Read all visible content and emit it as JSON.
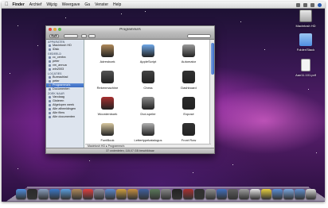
{
  "menubar": {
    "items": [
      "Finder",
      "Archief",
      "Wijzig",
      "Weergave",
      "Ga",
      "Venster",
      "Help"
    ]
  },
  "desktop": {
    "icons": [
      {
        "label": "Macintosh HD",
        "icon": "hard-drive-icon",
        "color": "#c8c8c8"
      },
      {
        "label": "Folder/Stack",
        "icon": "folder-icon",
        "color": "#6fa8e8"
      },
      {
        "label": "Aan11.101.pdf",
        "icon": "pdf-document-icon",
        "color": "#f2f2f2"
      }
    ]
  },
  "window": {
    "title": "Programma's",
    "search_placeholder": "",
    "sidebar": {
      "sections": [
        {
          "header": "APPARATEN",
          "items": [
            "Macintosh HD",
            "iDisk"
          ]
        },
        {
          "header": "GEDEELD",
          "items": [
            "cc_centra",
            "peter",
            "vm_annua",
            "win2003"
          ]
        },
        {
          "header": "LOCATIES",
          "items": [
            "Bureaublad",
            "peter",
            "Programma's",
            "Documenten"
          ]
        },
        {
          "header": "ZOEK NAAR",
          "items": [
            "Vandaag",
            "Gisteren",
            "Afgelopen week",
            "Alle afbeeldingen",
            "Alle films",
            "Alle documenten"
          ]
        }
      ],
      "selected": "Programma's"
    },
    "apps": [
      {
        "label": "Adresboek",
        "icon": "address-book-icon",
        "color": "#b08a5a"
      },
      {
        "label": "AppleScript",
        "icon": "applescript-folder-icon",
        "color": "#6fa8e8"
      },
      {
        "label": "Automator",
        "icon": "automator-icon",
        "color": "#9a9a9a"
      },
      {
        "label": "Rekenmachine",
        "icon": "calculator-icon",
        "color": "#555555"
      },
      {
        "label": "Chess",
        "icon": "chess-icon",
        "color": "#444444"
      },
      {
        "label": "Dashboard",
        "icon": "dashboard-icon",
        "color": "#333333"
      },
      {
        "label": "Woordenboek",
        "icon": "dictionary-icon",
        "color": "#a83030"
      },
      {
        "label": "Dvd-speler",
        "icon": "dvd-player-icon",
        "color": "#8a8a8a"
      },
      {
        "label": "Exposé",
        "icon": "expose-icon",
        "color": "#2a2a2a"
      },
      {
        "label": "FontBook",
        "icon": "font-book-icon",
        "color": "#d8c8a0"
      },
      {
        "label": "Lettertypekatalogus",
        "icon": "font-catalog-icon",
        "color": "#b0b0b0"
      },
      {
        "label": "Front Row",
        "icon": "front-row-icon",
        "color": "#333333"
      }
    ],
    "pathbar": "Macintosh HD ▸ Programma's",
    "status": "37 onderdelen, 115,07 GB beschikbaar"
  },
  "dock": {
    "items": [
      {
        "icon": "finder-icon",
        "color": "#4f8fe0"
      },
      {
        "icon": "dashboard-icon",
        "color": "#2a2a2a"
      },
      {
        "icon": "mail-icon",
        "color": "#8aa0c0"
      },
      {
        "icon": "safari-icon",
        "color": "#3a78c8"
      },
      {
        "icon": "ichat-icon",
        "color": "#5aa0e0"
      },
      {
        "icon": "address-book-icon",
        "color": "#b08a5a"
      },
      {
        "icon": "ical-icon",
        "color": "#e04040"
      },
      {
        "icon": "preview-icon",
        "color": "#9090a0"
      },
      {
        "icon": "itunes-icon",
        "color": "#5a8ad0"
      },
      {
        "icon": "iphoto-icon",
        "color": "#d0a040"
      },
      {
        "icon": "garageband-icon",
        "color": "#c89040"
      },
      {
        "icon": "spaces-icon",
        "color": "#4060a0"
      },
      {
        "icon": "time-machine-icon",
        "color": "#5a7a5a"
      },
      {
        "icon": "system-preferences-icon",
        "color": "#888888"
      },
      {
        "icon": "terminal-icon",
        "color": "#222222"
      },
      {
        "icon": "photo-booth-icon",
        "color": "#aa3030"
      },
      {
        "icon": "frontrow-icon",
        "color": "#303030"
      },
      {
        "icon": "dvd-icon",
        "color": "#909090"
      },
      {
        "icon": "quicktime-icon",
        "color": "#4070c0"
      },
      {
        "icon": "chess-icon",
        "color": "#606060"
      },
      {
        "icon": "automator-icon",
        "color": "#a0a0a0"
      },
      {
        "icon": "textedit-icon",
        "color": "#e8e8e8"
      },
      {
        "icon": "stickies-icon",
        "color": "#e8d040"
      },
      {
        "icon": "applications-stack-icon",
        "color": "#5a90d8"
      },
      {
        "icon": "documents-stack-icon",
        "color": "#7aa8e0"
      },
      {
        "icon": "downloads-stack-icon",
        "color": "#6090d0"
      },
      {
        "icon": "trash-icon",
        "color": "#d8d8d8"
      }
    ]
  }
}
